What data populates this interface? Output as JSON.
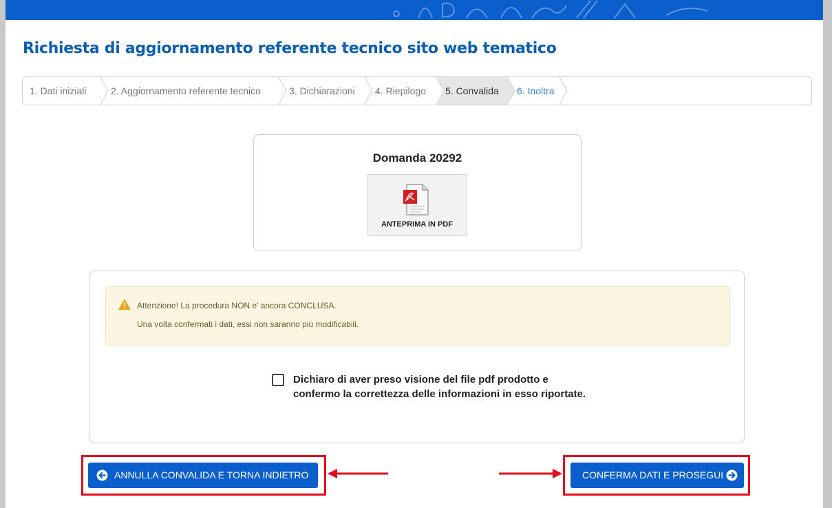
{
  "page": {
    "title": "Richiesta di aggiornamento referente tecnico sito web tematico"
  },
  "stepper": {
    "steps": [
      {
        "label": "1. Dati iniziali",
        "state": "done"
      },
      {
        "label": "2. Aggiornamento referente tecnico",
        "state": "done"
      },
      {
        "label": "3. Dichiarazioni",
        "state": "done"
      },
      {
        "label": "4. Riepilogo",
        "state": "done"
      },
      {
        "label": "5. Convalida",
        "state": "active"
      },
      {
        "label": "6. Inoltra",
        "state": "next"
      }
    ]
  },
  "document": {
    "title": "Domanda 20292",
    "preview_label": "ANTEPRIMA IN PDF",
    "icon": "pdf-file-icon"
  },
  "alert": {
    "icon": "warning-icon",
    "line1": "Attenzione! La procedura NON e' ancora CONCLUSA.",
    "line2": "Una volta confermati i dati, essi non saranno più modificabili."
  },
  "declaration": {
    "checked": false,
    "text": "Dichiaro di aver preso visione del file pdf prodotto e confermo la correttezza delle informazioni in esso riportate."
  },
  "buttons": {
    "back_label": "ANNULLA CONVALIDA E TORNA INDIETRO",
    "back_icon": "arrow-circle-left-icon",
    "next_label": "CONFERMA DATI E PROSEGUI",
    "next_icon": "arrow-circle-right-icon"
  },
  "colors": {
    "primary": "#0a5fcc",
    "title": "#0a5fb5",
    "highlight": "#e30b1c",
    "alert_bg": "#fcf5e1",
    "warning": "#f0a21b"
  }
}
